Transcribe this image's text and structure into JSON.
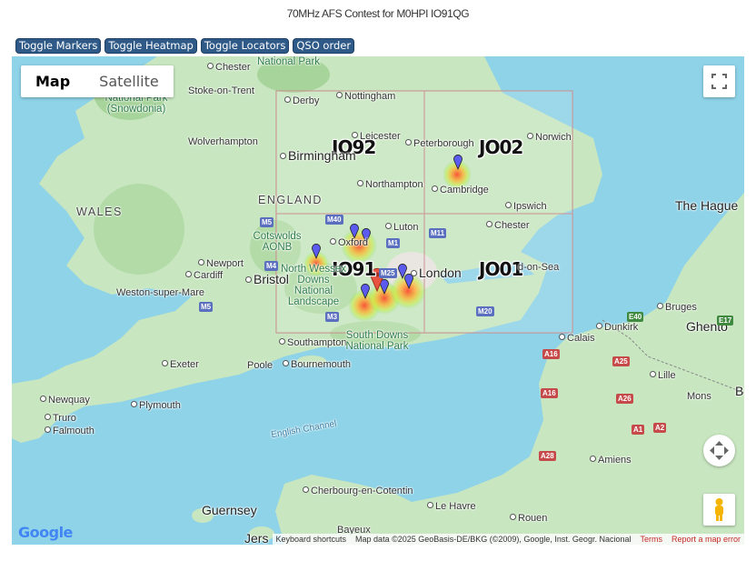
{
  "title": "70MHz AFS Contest for M0HPI IO91QG",
  "toolbar": {
    "markers": "Toggle Markers",
    "heatmap": "Toggle Heatmap",
    "locators": "Toggle Locators",
    "qso_order": "QSO order"
  },
  "map_type": {
    "map": "Map",
    "satellite": "Satellite",
    "selected": "Map"
  },
  "locators": {
    "io92": "IO92",
    "jo02": "JO02",
    "io91": "IO91",
    "jo01": "JO01"
  },
  "places": {
    "chester": "Chester",
    "stoke": "Stoke-on-Trent",
    "snowdonia": "National Park (Snowdonia)",
    "peak": "National Park",
    "derby": "Derby",
    "nottingham": "Nottingham",
    "wolverhampton": "Wolverhampton",
    "birmingham": "Birmingham",
    "leicester": "Leicester",
    "peterborough": "Peterborough",
    "norwich": "Norwich",
    "england": "ENGLAND",
    "northampton": "Northampton",
    "cambridge": "Cambridge",
    "ipswich": "Ipswich",
    "wales": "WALES",
    "the_hague": "The Hague",
    "cotswolds": "Cotswolds AONB",
    "oxford": "Oxford",
    "luton": "Luton",
    "chelmsford": "Chester",
    "newport": "Newport",
    "cardiff": "Cardiff",
    "bristol": "Bristol",
    "north_wessex": "North Wessex Downs National Landscape",
    "london": "London",
    "southend": "d-on-Sea",
    "weston": "Weston-super-Mare",
    "southampton": "Southampton",
    "south_downs": "South Downs National Park",
    "calais": "Calais",
    "dunkirk": "Dunkirk",
    "bruges": "Bruges",
    "ghent": "Ghento",
    "exeter": "Exeter",
    "poole": "Poole",
    "bournemouth": "Bournemouth",
    "lille": "Lille",
    "mons": "Mons",
    "newquay": "Newquay",
    "plymouth": "Plymouth",
    "truro": "Truro",
    "falmouth": "Falmouth",
    "english_channel": "English Channel",
    "amiens": "Amiens",
    "guernsey": "Guernsey",
    "cherbourg": "Cherbourg-en-Cotentin",
    "le_havre": "Le Havre",
    "rouen": "Rouen",
    "jersey": "Jers",
    "bayeux": "Bayeux",
    "b": "B"
  },
  "roads": {
    "m40": "M40",
    "m11": "M11",
    "m5a": "M5",
    "m1": "M1",
    "m25": "M25",
    "m4": "M4",
    "m5b": "M5",
    "m3": "M3",
    "m20": "M20",
    "a16a": "A16",
    "a25": "A25",
    "e40": "E40",
    "e17": "E17",
    "a16b": "A16",
    "a26": "A26",
    "a1": "A1",
    "a2": "A2",
    "a28": "A28"
  },
  "attribution": {
    "shortcuts": "Keyboard shortcuts",
    "map_data": "Map data ©2025 GeoBasis-DE/BKG (©2009), Google, Inst. Geogr. Nacional",
    "terms": "Terms",
    "report": "Report a map error",
    "google": "Google"
  },
  "colors": {
    "button": "#2f5a88",
    "water": "#8fd3e8",
    "land": "#c8e6c0",
    "marker": "#5b5bf0",
    "home_marker": "#e8533f"
  }
}
